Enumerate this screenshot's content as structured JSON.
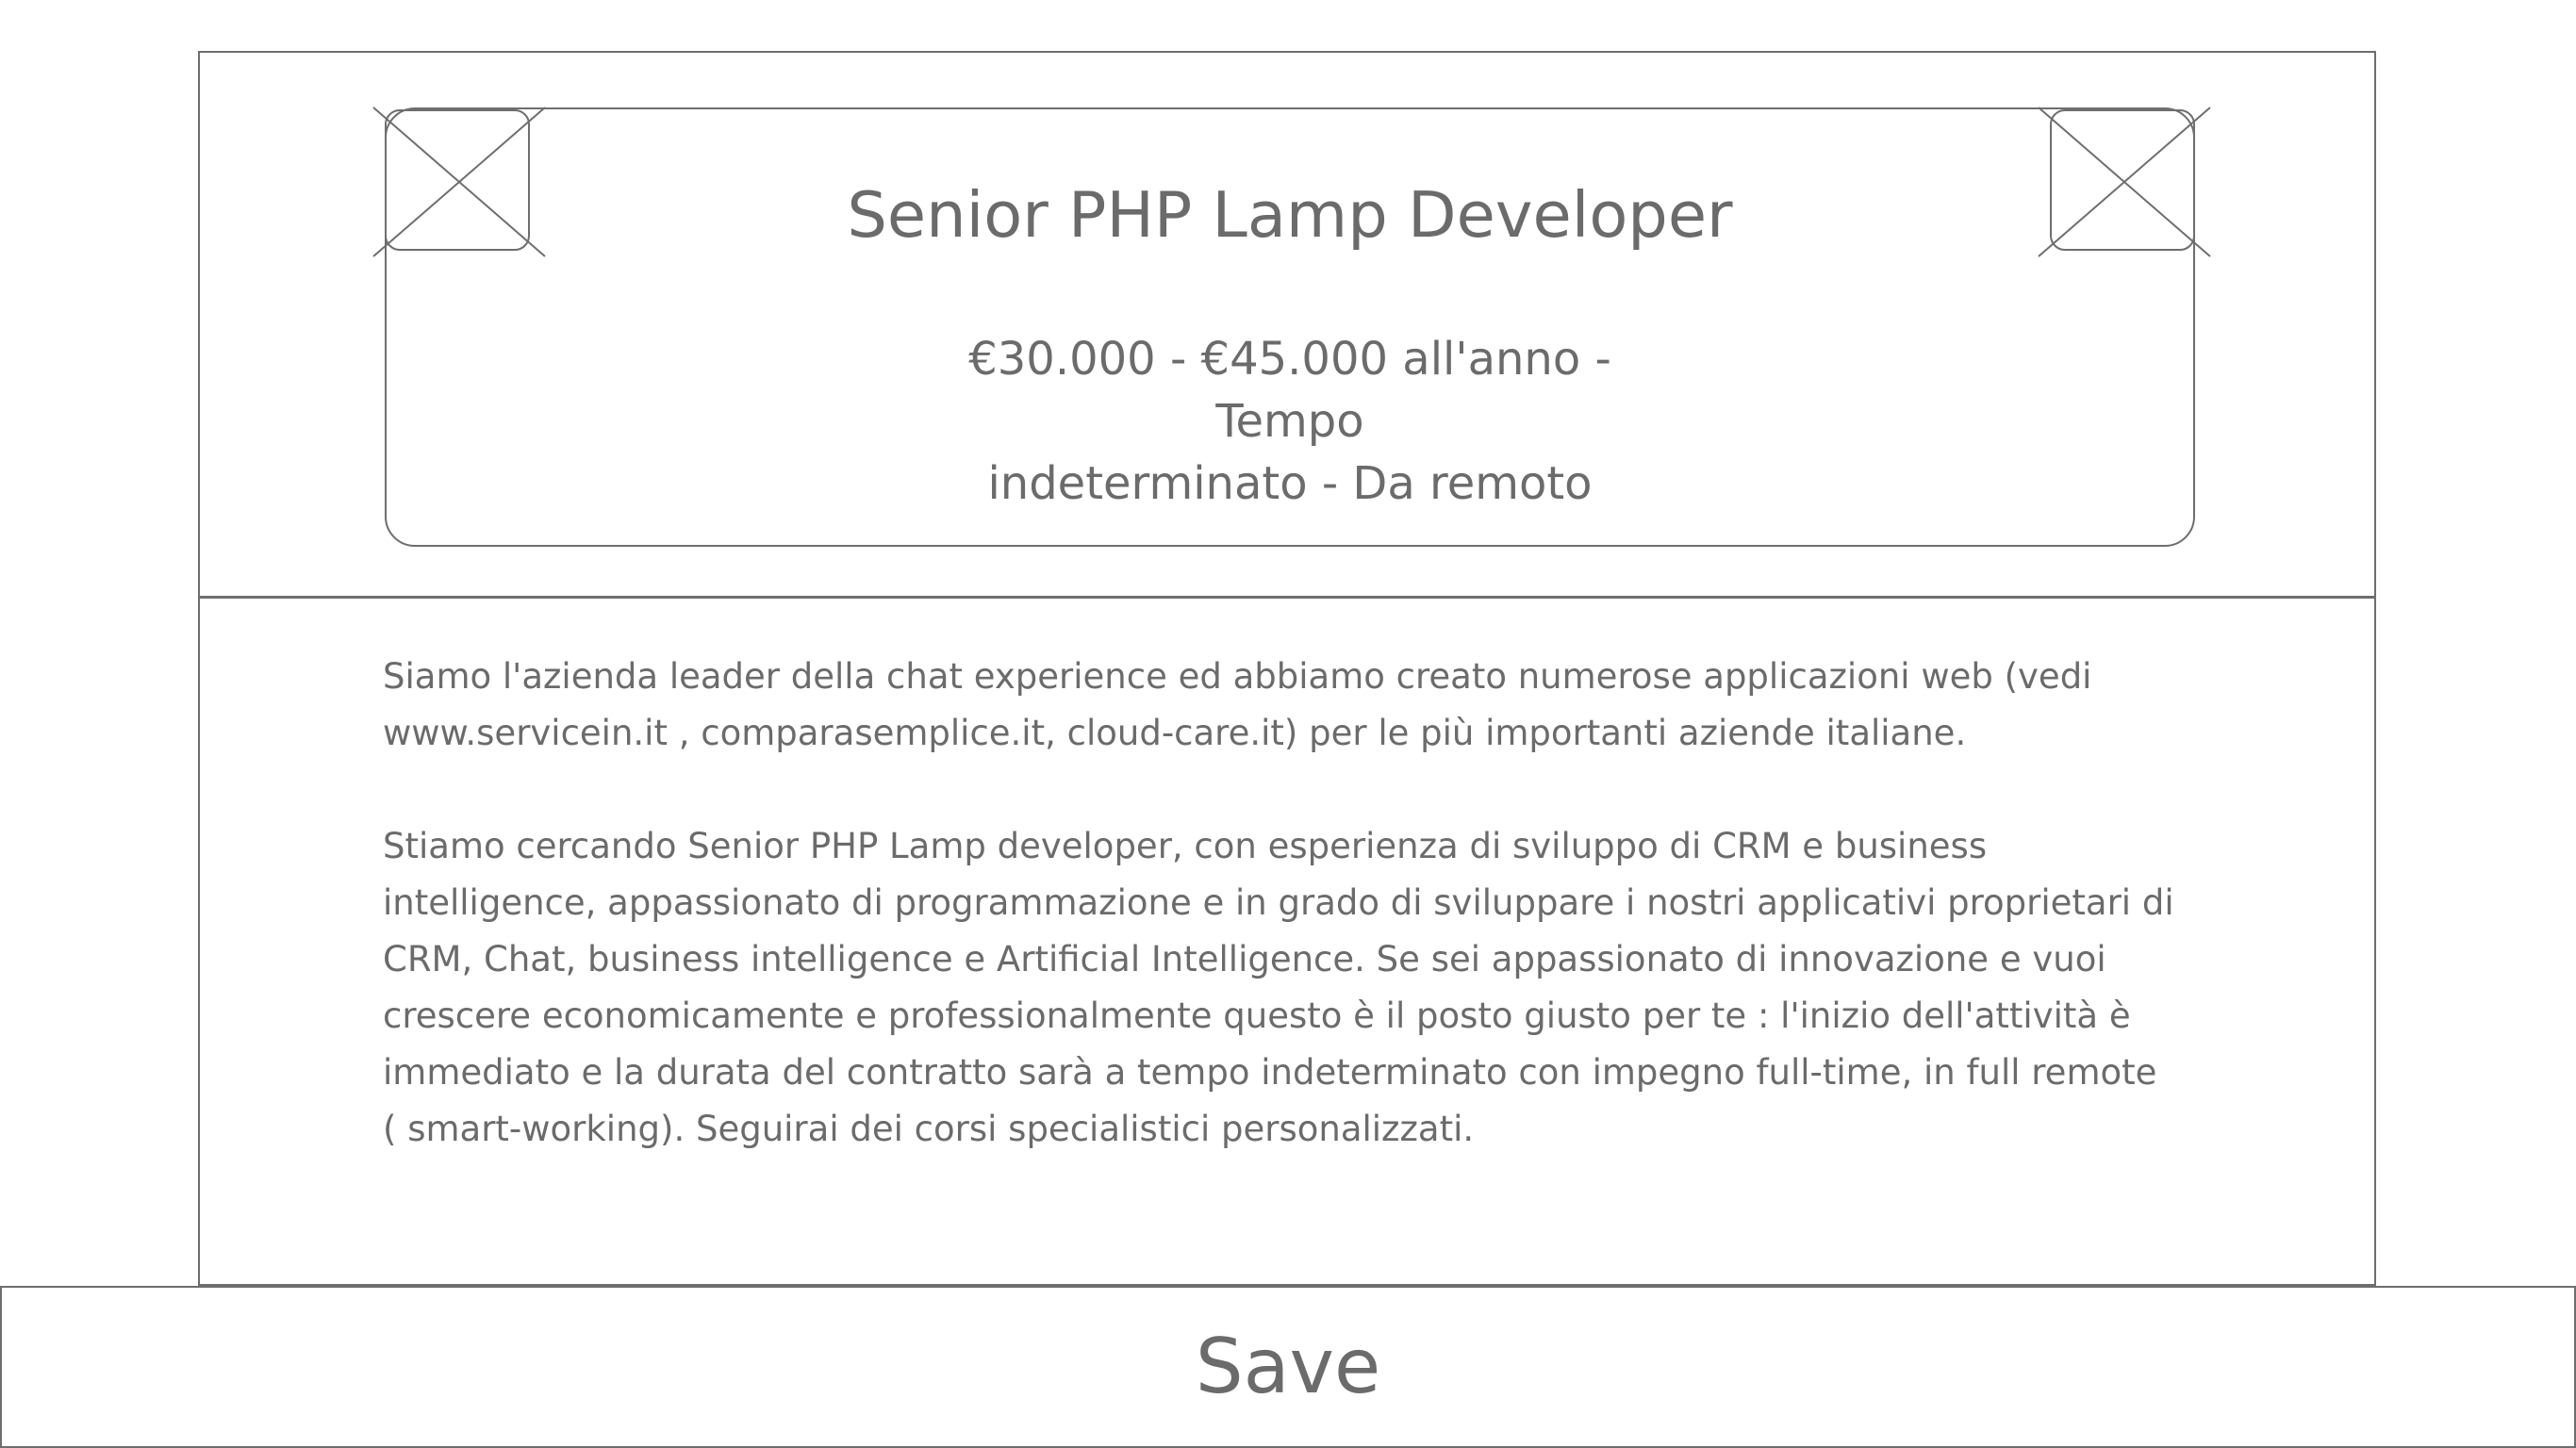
{
  "header": {
    "title": "Senior PHP Lamp Developer",
    "meta_line_1": "€30.000 - €45.000 all'anno - Tempo",
    "meta_line_2": "indeterminato - Da remoto"
  },
  "description": {
    "paragraph_1_line_1": "Siamo l'azienda leader della chat experience ed abbiamo creato numerose applicazioni web (vedi",
    "paragraph_1_line_2": "www.servicein.it , comparasemplice.it, cloud-care.it) per le più importanti aziende italiane.",
    "paragraph_2_line_1": "Stiamo cercando Senior PHP Lamp developer, con esperienza di sviluppo di CRM e business",
    "paragraph_2_line_2": "intelligence, appassionato di programmazione e in grado di sviluppare i nostri applicativi proprietari di",
    "paragraph_2_line_3": "CRM, Chat, business intelligence e Artificial Intelligence. Se sei appassionato di innovazione e vuoi",
    "paragraph_2_line_4": "crescere economicamente e professionalmente questo è il posto giusto per te : l'inizio dell'attività è",
    "paragraph_2_line_5": "immediato e la durata del contratto sarà a tempo indeterminato con impegno full-time, in full remote",
    "paragraph_2_line_6": "( smart-working). Seguirai dei corsi specialistici personalizzati."
  },
  "footer": {
    "save_label": "Save"
  },
  "icons": {
    "left_placeholder": "image-placeholder-icon",
    "right_placeholder": "image-placeholder-icon"
  },
  "colors": {
    "stroke": "#6e6e6e",
    "text": "#6b6b6b",
    "background": "#ffffff"
  }
}
